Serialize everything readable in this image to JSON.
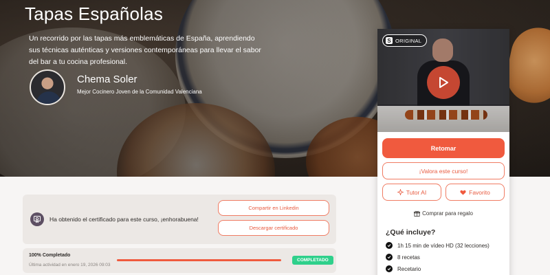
{
  "hero": {
    "title": "Tapas Españolas",
    "description": "Un recorrido por las tapas más emblemáticas de España, aprendiendo sus técnicas auténticas y versiones contemporáneas para llevar el sabor del bar a tu cocina profesional.",
    "teacher": {
      "name": "Chema Soler",
      "role": "Mejor Cocinero Joven de la Comunidad Valenciana"
    }
  },
  "certificate": {
    "message": "Ha obtenido el certificado para este curso, ¡enhorabuena!",
    "share_label": "Compartir en Linkedin",
    "download_label": "Descargar certificado"
  },
  "progress": {
    "title": "100% Completado",
    "last_activity": "Última actividad en enero 19, 2026 09:03",
    "percent": 100,
    "badge": "COMPLETADO"
  },
  "sidebar": {
    "badge": "ORIGINAL",
    "resume_label": "Retomar",
    "rate_label": "¡Valora este curso!",
    "tutor_label": "Tutor AI",
    "favorite_label": "Favorito",
    "gift_label": "Comprar para regalo",
    "includes_title": "¿Qué incluye?",
    "includes": [
      "1h 15 min de vídeo HD (32 lecciones)",
      "8 recetas",
      "Recetario"
    ]
  },
  "colors": {
    "accent": "#f05a3e",
    "success": "#2fd08b"
  }
}
